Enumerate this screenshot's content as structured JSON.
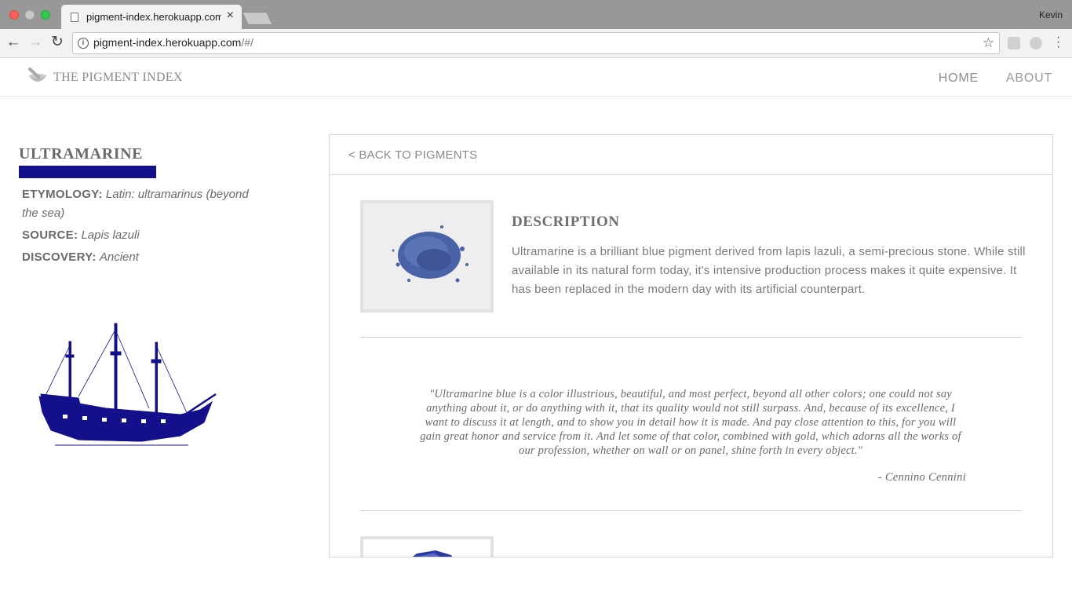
{
  "browser": {
    "tab_title": "pigment-index.herokuapp.com/#/",
    "tab_close": "×",
    "profile_name": "Kevin",
    "url_host": "pigment-index.herokuapp.com",
    "url_path": "/#/",
    "back_glyph": "←",
    "forward_glyph": "→",
    "reload_glyph": "↻",
    "star_glyph": "☆"
  },
  "site": {
    "logo_text": "THE PIGMENT INDEX",
    "nav": {
      "home": "HOME",
      "about": "ABOUT"
    }
  },
  "pigment": {
    "name": "ULTRAMARINE",
    "swatch_color": "#14108c",
    "etymology_label": "ETYMOLOGY:",
    "etymology_value": "Latin: ultramarinus (beyond the sea)",
    "source_label": "SOURCE:",
    "source_value": "Lapis lazuli",
    "discovery_label": "DISCOVERY:",
    "discovery_value": "Ancient"
  },
  "panel": {
    "back_link": "< BACK TO PIGMENTS",
    "description_title": "DESCRIPTION",
    "description_text": "Ultramarine is a brilliant blue pigment derived from lapis lazuli, a semi-precious stone. While still available in its natural form today, it's intensive production process makes it quite expensive. It has been replaced in the modern day with its artificial counterpart.",
    "quote": "\"Ultramarine blue is a color illustrious, beautiful, and most perfect, beyond all other colors; one could not say anything about it, or do anything with it, that its quality would not still surpass. And, because of its excellence, I want to discuss it at length, and to show you in detail how it is made. And pay close attention to this, for you will gain great honor and service from it. And let some of that color, combined with gold, which adorns all the works of our profession, whether on wall or on panel, shine forth in every object.\"",
    "quote_author": "- Cennino Cennini"
  },
  "icons": {
    "logo": "mortar-pestle-icon",
    "ship": "sailing-ship-illustration",
    "thumb_powder": "pigment-powder-photo",
    "thumb_stone": "lapis-stone-photo"
  }
}
